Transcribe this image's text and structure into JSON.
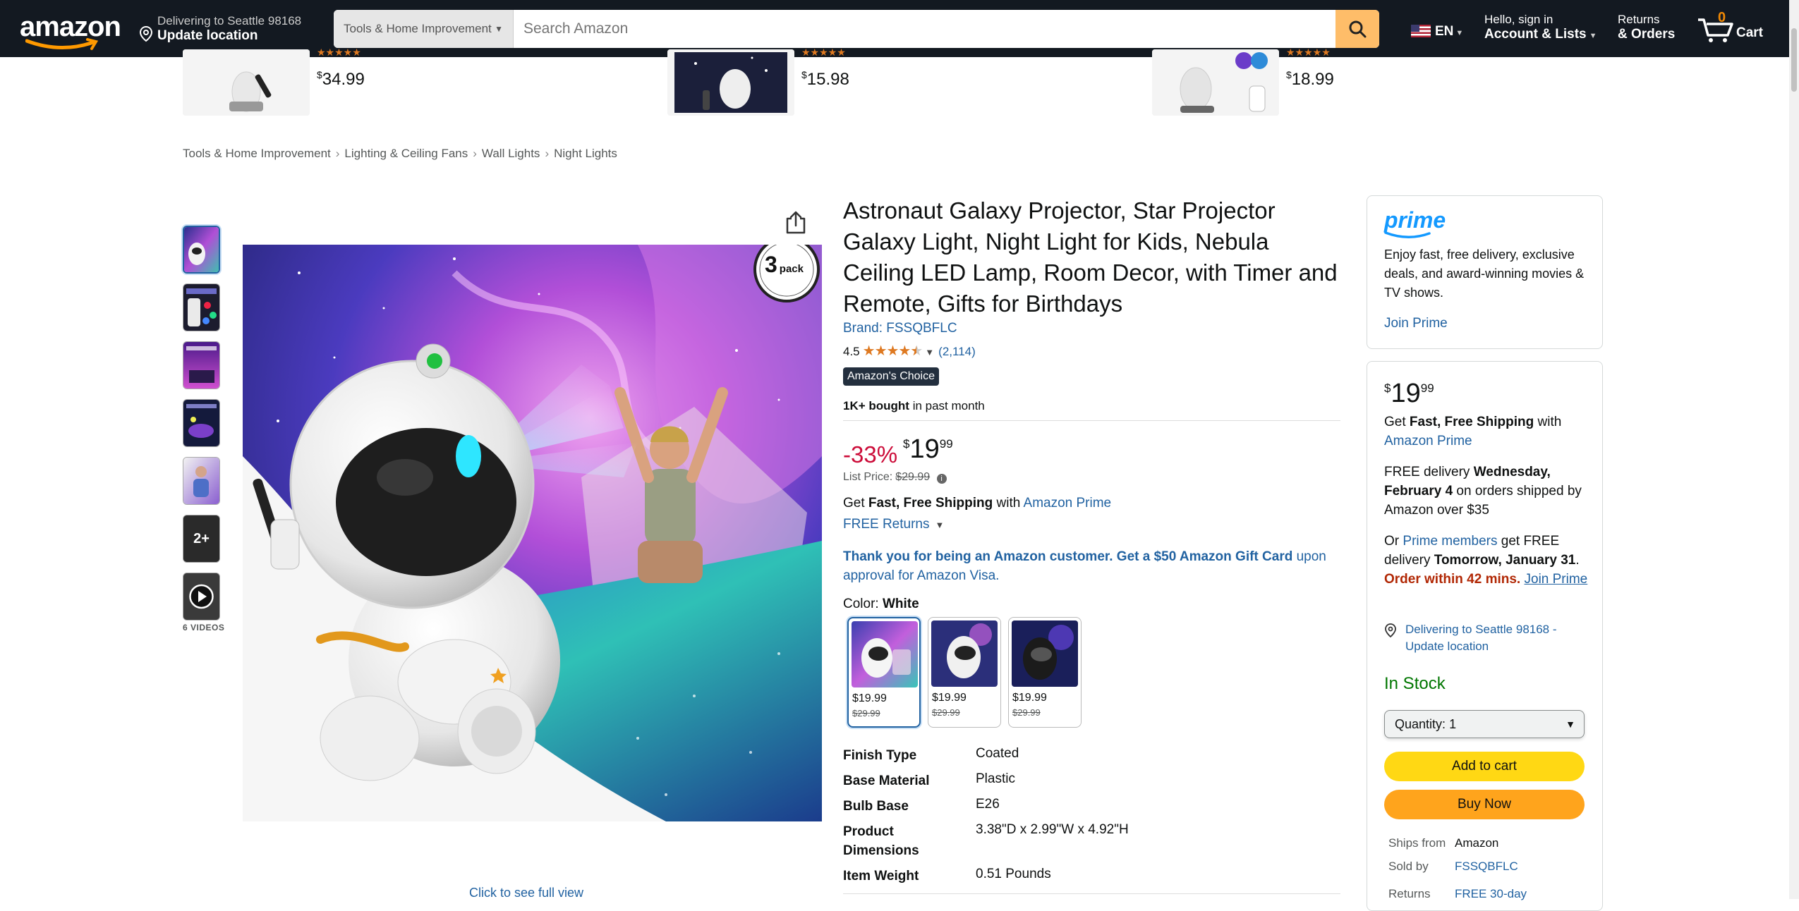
{
  "header": {
    "logo": "amazon",
    "deliver_line1": "Delivering to Seattle 98168",
    "deliver_line2": "Update location",
    "search_category": "Tools & Home Improvement",
    "search_placeholder": "Search Amazon",
    "language": "EN",
    "account_line1": "Hello, sign in",
    "account_line2": "Account & Lists",
    "orders_line1": "Returns",
    "orders_line2": "& Orders",
    "cart_count": "0",
    "cart_label": "Cart"
  },
  "strip": [
    {
      "currency": "$",
      "price": "34.99"
    },
    {
      "currency": "$",
      "price": "15.98"
    },
    {
      "currency": "$",
      "price": "18.99"
    }
  ],
  "breadcrumb": [
    "Tools & Home Improvement",
    "Lighting & Ceiling Fans",
    "Wall Lights",
    "Night Lights"
  ],
  "breadcrumb_sep": "›",
  "gallery": {
    "more_label": "2+",
    "videos_label": "6 VIDEOS",
    "badge_number": "3",
    "badge_word": "pack",
    "click_full": "Click to see full view"
  },
  "product": {
    "title": "Astronaut Galaxy Projector, Star Projector Galaxy Light, Night Light for Kids, Nebula Ceiling LED Lamp, Room Decor, with Timer and Remote, Gifts for Birthdays",
    "brand": "Brand: FSSQBFLC",
    "rating": "4.5",
    "rating_value": 4.5,
    "review_count": "(2,114)",
    "choice_badge": "Amazon's Choice",
    "bought_bold": "1K+ bought",
    "bought_rest": " in past month",
    "discount": "-33%",
    "currency": "$",
    "price_whole": "19",
    "price_frac": "99",
    "list_price_label": "List Price:",
    "list_price": "$29.99",
    "ship_pre": "Get ",
    "ship_bold": "Fast, Free Shipping",
    "ship_mid": " with ",
    "ship_link": "Amazon Prime",
    "free_returns": "FREE Returns",
    "gift_bold": "Thank you for being an Amazon customer. Get a $50 Amazon Gift Card",
    "gift_rest": " upon approval for Amazon Visa.",
    "color_label": "Color:",
    "color_value": "White",
    "swatches": [
      {
        "price": "$19.99",
        "list": "$29.99"
      },
      {
        "price": "$19.99",
        "list": "$29.99"
      },
      {
        "price": "$19.99",
        "list": "$29.99"
      }
    ],
    "specs": [
      {
        "k": "Finish Type",
        "v": "Coated"
      },
      {
        "k": "Base Material",
        "v": "Plastic"
      },
      {
        "k": "Bulb Base",
        "v": "E26"
      },
      {
        "k": "Product Dimensions",
        "v": "3.38\"D x 2.99\"W x 4.92\"H"
      },
      {
        "k": "Item Weight",
        "v": "0.51 Pounds"
      }
    ]
  },
  "prime_box": {
    "logo": "prime",
    "text": "Enjoy fast, free delivery, exclusive deals, and award-winning movies & TV shows.",
    "join": "Join Prime"
  },
  "buy_box": {
    "currency": "$",
    "price_whole": "19",
    "price_frac": "99",
    "ship_pre": "Get ",
    "ship_bold": "Fast, Free Shipping",
    "ship_mid": " with ",
    "ship_link": "Amazon Prime",
    "free_pre": "FREE delivery ",
    "free_bold": "Wednesday, February 4",
    "free_rest": " on orders shipped by Amazon over $35",
    "or_pre": "Or ",
    "or_link": "Prime members",
    "or_mid": " get FREE delivery ",
    "or_bold": "Tomorrow, January 31",
    "or_dot": ".",
    "order_within": "Order within 42 mins.",
    "join_prime": "Join Prime",
    "location": "Delivering to Seattle 98168 - Update location",
    "in_stock": "In Stock",
    "quantity_label": "Quantity:",
    "quantity_value": "1",
    "add_to_cart": "Add to cart",
    "buy_now": "Buy Now",
    "ships_from_label": "Ships from",
    "ships_from": "Amazon",
    "sold_by_label": "Sold by",
    "sold_by": "FSSQBFLC",
    "returns_label": "Returns",
    "returns_value": "FREE 30-day"
  },
  "colors": {
    "header_bg": "#131921",
    "search_btn": "#febd69",
    "link": "#2162a1",
    "deal_red": "#cc0c39",
    "in_stock": "#007600",
    "add_to_cart": "#ffd814",
    "buy_now": "#ffa41c",
    "stars": "#de7921"
  }
}
